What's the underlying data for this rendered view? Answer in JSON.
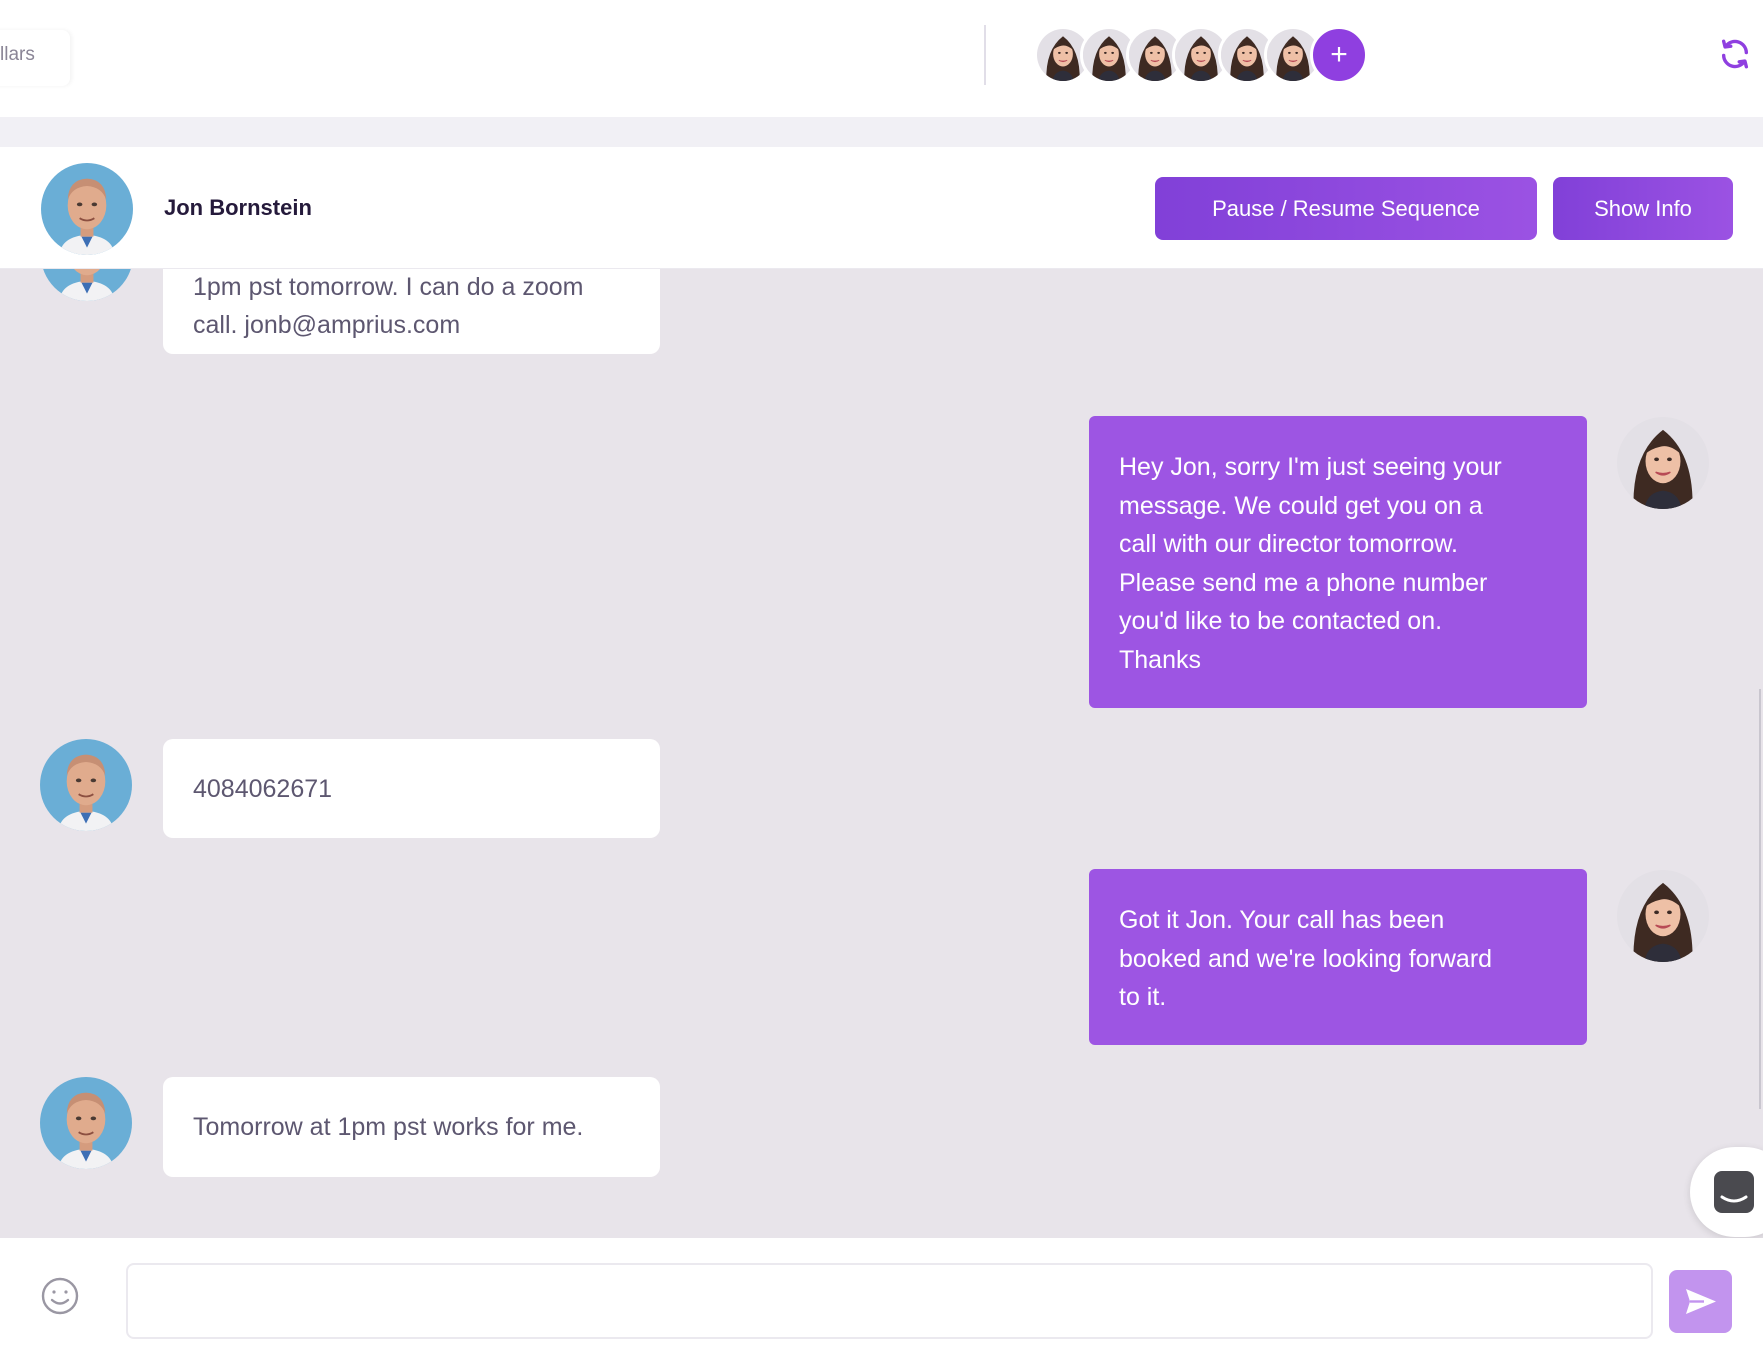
{
  "topbar": {
    "tab_label": "llars",
    "agents": [
      {
        "name": "agent-avatar-1"
      },
      {
        "name": "agent-avatar-2"
      },
      {
        "name": "agent-avatar-3"
      },
      {
        "name": "agent-avatar-4"
      },
      {
        "name": "agent-avatar-5"
      },
      {
        "name": "agent-avatar-6"
      }
    ],
    "add_label": "+",
    "refresh_icon": "refresh-icon"
  },
  "contact": {
    "name": "Jon Bornstein"
  },
  "actions": {
    "pause_resume_label": "Pause / Resume Sequence",
    "show_info_label": "Show Info"
  },
  "messages": [
    {
      "direction": "in",
      "lines": [
        "1pm pst tomorrow. I can do a zoom",
        "call. jonb@amprius.com"
      ]
    },
    {
      "direction": "out",
      "lines": [
        "Hey Jon, sorry I'm just seeing your",
        "message. We could get you on a",
        "call with our director tomorrow.",
        "Please send me a phone number",
        "you'd like to be contacted on.",
        "Thanks"
      ]
    },
    {
      "direction": "in",
      "lines": [
        "4084062671"
      ]
    },
    {
      "direction": "out",
      "lines": [
        "Got it Jon. Your call has been",
        "booked and we're looking forward",
        "to it."
      ]
    },
    {
      "direction": "in",
      "lines": [
        "Tomorrow at 1pm pst works for me."
      ]
    }
  ],
  "composer": {
    "placeholder": "",
    "emoji_icon": "smiley-icon",
    "send_icon": "send-icon"
  },
  "colors": {
    "accent": "#8743dc",
    "outgoing_bubble": "#9d55e3",
    "chat_background": "#e8e4ea",
    "send_button": "#c294ee"
  }
}
